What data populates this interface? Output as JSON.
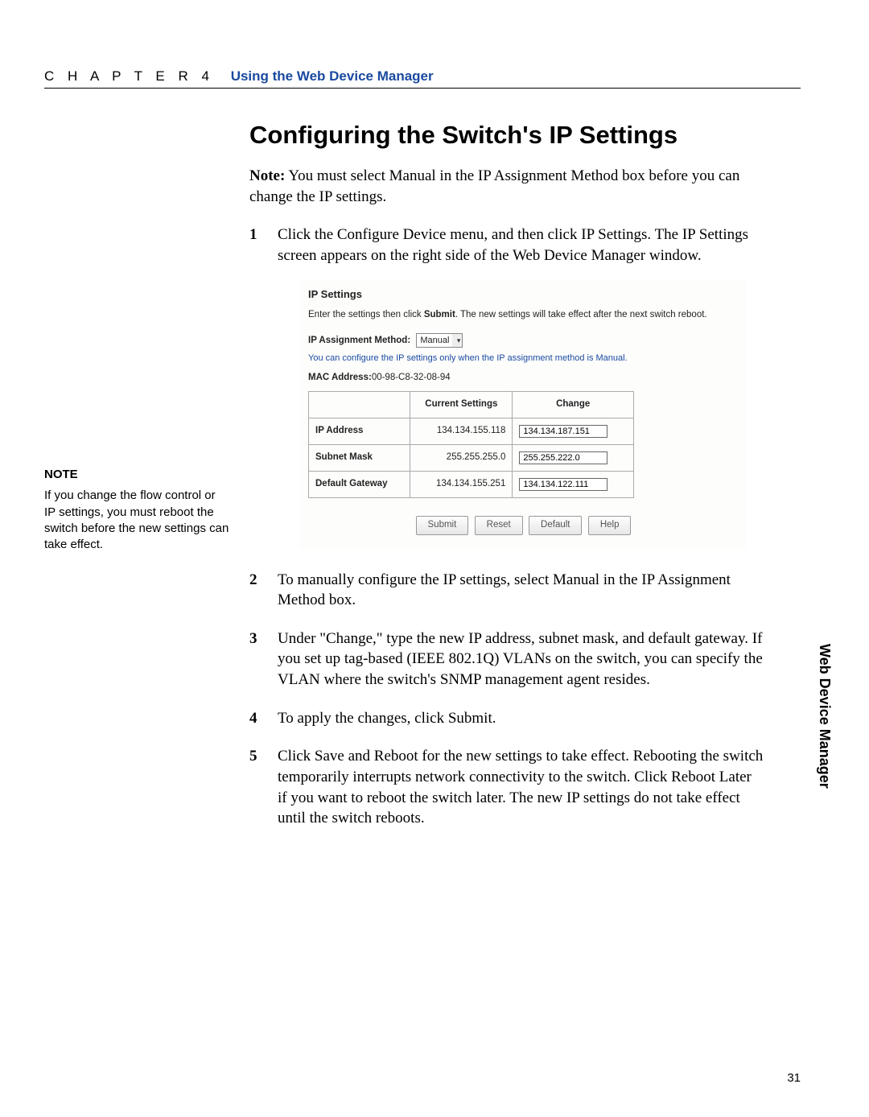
{
  "header": {
    "chapter_label": "C H A P T E R  4",
    "title": "Using the Web Device Manager"
  },
  "section_title": "Configuring the Switch's IP Settings",
  "note_line": {
    "label": "Note:",
    "text": " You must select Manual in the IP Assignment Method box before you can change the IP settings."
  },
  "steps": [
    "Click the Configure Device menu, and then click IP Settings. The IP Settings screen appears on the right side of the Web Device Manager window.",
    "To manually configure the IP settings, select Manual in the IP Assignment Method box.",
    "Under \"Change,\" type the new IP address, subnet mask, and default gateway. If you set up tag-based (IEEE 802.1Q) VLANs on the switch, you can specify the VLAN where the switch's SNMP management agent resides.",
    "To apply the changes, click Submit.",
    "Click Save and Reboot for the new settings to take effect. Rebooting the switch temporarily interrupts network connectivity to the switch. Click Reboot Later if you want to reboot the switch later. The new IP settings do not take effect until the switch reboots."
  ],
  "sidenote": {
    "title": "NOTE",
    "text": "If you change the flow control or IP settings, you must reboot the switch before the new settings can take effect."
  },
  "screenshot": {
    "title": "IP Settings",
    "instruction_pre": "Enter the settings then click ",
    "instruction_bold": "Submit",
    "instruction_post": ". The new settings will take effect after the next switch reboot.",
    "assignment_label": "IP Assignment Method:",
    "assignment_value": "Manual",
    "blue_text": "You can configure the IP settings only when the IP assignment method is Manual.",
    "mac_label": "MAC Address:",
    "mac_value": "00-98-C8-32-08-94",
    "table": {
      "col_current": "Current Settings",
      "col_change": "Change",
      "rows": [
        {
          "label": "IP Address",
          "current": "134.134.155.118",
          "change": "134.134.187.151"
        },
        {
          "label": "Subnet Mask",
          "current": "255.255.255.0",
          "change": "255.255.222.0"
        },
        {
          "label": "Default Gateway",
          "current": "134.134.155.251",
          "change": "134.134.122.111"
        }
      ]
    },
    "buttons": [
      "Submit",
      "Reset",
      "Default",
      "Help"
    ]
  },
  "right_tab": "Web Device Manager",
  "page_number": "31"
}
